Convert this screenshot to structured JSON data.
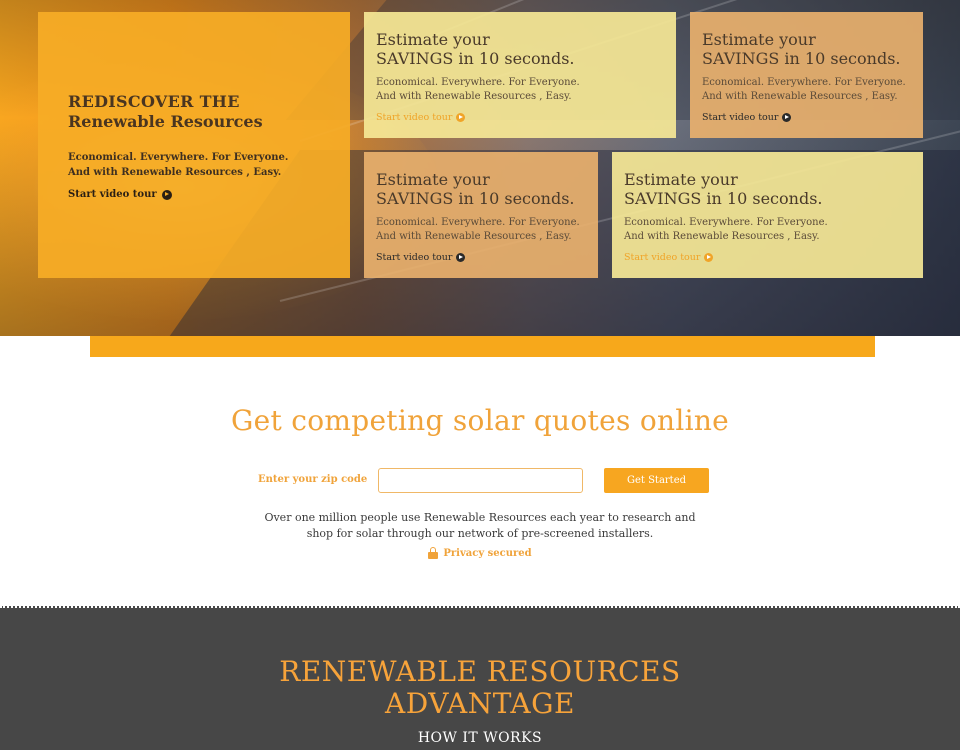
{
  "hero": {
    "main_card": {
      "title_line1": "REDISCOVER THE",
      "title_line2": "Renewable Resources",
      "subtitle_line1": "Economical. Everywhere. For Everyone.",
      "subtitle_line2": "And with Renewable Resources , Easy.",
      "link": "Start video tour"
    },
    "cards": [
      {
        "title_line1": "Estimate your",
        "title_line2": "SAVINGS in 10 seconds.",
        "subtitle_line1": "Economical. Everywhere. For Everyone.",
        "subtitle_line2": "And with Renewable Resources , Easy.",
        "link": "Start video tour",
        "color": "yellow"
      },
      {
        "title_line1": "Estimate your",
        "title_line2": "SAVINGS in 10 seconds.",
        "subtitle_line1": "Economical. Everywhere. For Everyone.",
        "subtitle_line2": "And with Renewable Resources , Easy.",
        "link": "Start video tour",
        "color": "tan"
      },
      {
        "title_line1": "Estimate your",
        "title_line2": "SAVINGS in 10 seconds.",
        "subtitle_line1": "Economical. Everywhere. For Everyone.",
        "subtitle_line2": "And with Renewable Resources , Easy.",
        "link": "Start video tour",
        "color": "tan"
      },
      {
        "title_line1": "Estimate your",
        "title_line2": "SAVINGS in 10 seconds.",
        "subtitle_line1": "Economical. Everywhere. For Everyone.",
        "subtitle_line2": "And with Renewable Resources , Easy.",
        "link": "Start video tour",
        "color": "yellow"
      }
    ],
    "icons": {
      "play": "play-circle-icon"
    }
  },
  "quote": {
    "title": "Get competing solar quotes online",
    "zip_label": "Enter your zip code",
    "zip_value": "",
    "zip_placeholder": "",
    "button_label": "Get Started",
    "description_line1": "Over one million people use Renewable Resources each year to research and",
    "description_line2": "shop for solar through our network of pre-screened installers.",
    "privacy": "Privacy secured",
    "icons": {
      "privacy": "lock-icon"
    }
  },
  "advantage": {
    "title_line1": "RENEWABLE RESOURCES",
    "title_line2": "ADVANTAGE",
    "subtitle": "HOW IT WORKS"
  },
  "colors": {
    "accent": "#f7a81b",
    "heading_orange": "#f0a33a",
    "dark_section": "#474747",
    "card_yellow": "#f6e896",
    "card_tan": "#ecb26e"
  }
}
